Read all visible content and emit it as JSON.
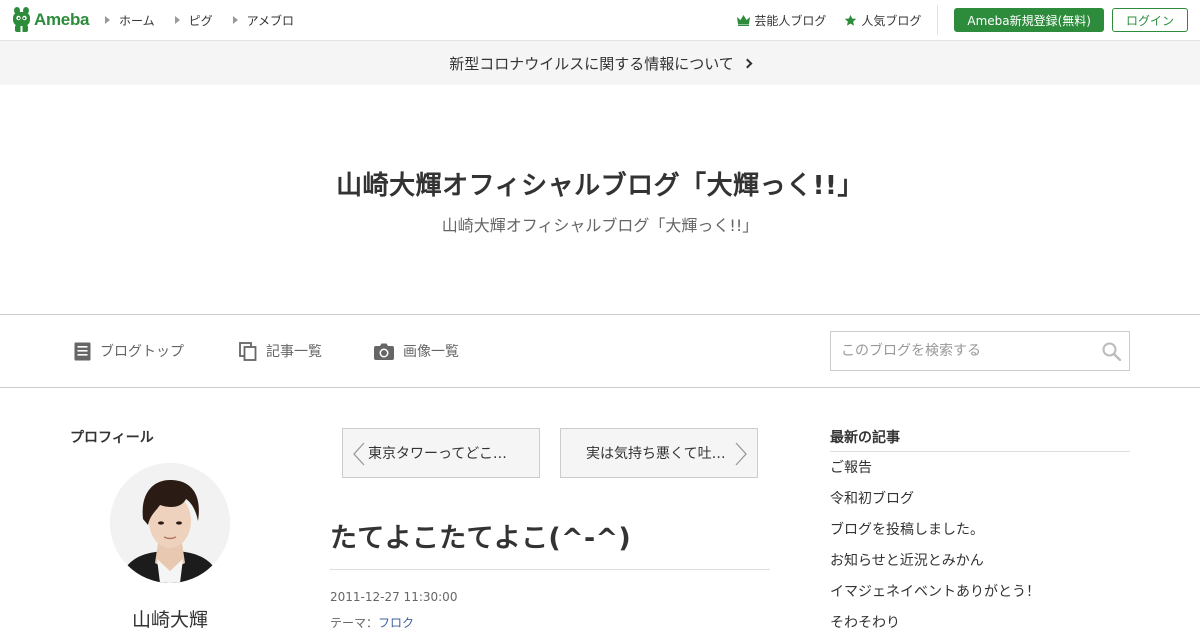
{
  "header": {
    "logo_text": "Ameba",
    "nav": [
      {
        "label": "ホーム"
      },
      {
        "label": "ピグ"
      },
      {
        "label": "アメブロ"
      }
    ],
    "celebrity_blog": "芸能人ブログ",
    "popular_blog": "人気ブログ",
    "register_label": "Ameba新規登録(無料)",
    "login_label": "ログイン",
    "accent_color": "#2d8c3c"
  },
  "notice": {
    "text": "新型コロナウイルスに関する情報について"
  },
  "blog": {
    "title": "山崎大輝オフィシャルブログ「大輝っく!!」",
    "description": "山崎大輝オフィシャルブログ「大輝っく!!」"
  },
  "blog_nav": {
    "top": "ブログトップ",
    "entries": "記事一覧",
    "images": "画像一覧",
    "search_placeholder": "このブログを検索する"
  },
  "profile": {
    "heading": "プロフィール",
    "name": "山崎大輝"
  },
  "pager": {
    "prev": "東京タワーってどこ…",
    "next": "実は気持ち悪くて吐…"
  },
  "entry": {
    "title": "たてよこたてよこ(^-^)",
    "date": "2011-12-27 11:30:00",
    "theme_label": "テーマ：",
    "theme": "フロク"
  },
  "recent": {
    "heading": "最新の記事",
    "items": [
      "ご報告",
      "令和初ブログ",
      "ブログを投稿しました。",
      "お知らせと近況とみかん",
      "イマジェネイベントありがとう！",
      "そわそわり"
    ]
  }
}
